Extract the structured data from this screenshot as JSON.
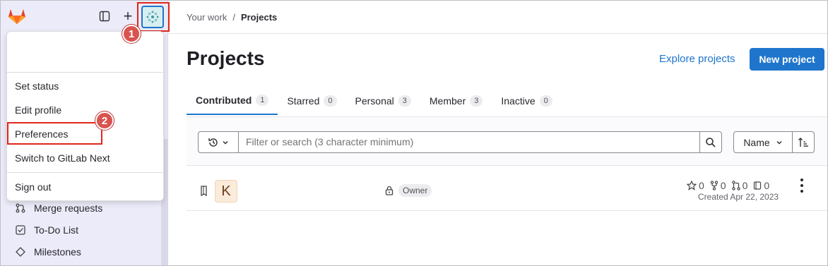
{
  "sidebar": {
    "logo_icon": "gitlab-tanuki-icon",
    "nav": [
      {
        "icon": "merge-request-icon",
        "label": "Merge requests"
      },
      {
        "icon": "todo-icon",
        "label": "To-Do List"
      },
      {
        "icon": "milestone-icon",
        "label": "Milestones"
      }
    ]
  },
  "dropdown": {
    "items": {
      "set_status": "Set status",
      "edit_profile": "Edit profile",
      "preferences": "Preferences",
      "switch_next": "Switch to GitLab Next",
      "sign_out": "Sign out"
    }
  },
  "annotations": {
    "step1": "1",
    "step2": "2"
  },
  "breadcrumb": {
    "parent": "Your work",
    "separator": "/",
    "current": "Projects"
  },
  "page": {
    "title": "Projects",
    "explore_label": "Explore projects",
    "new_project_label": "New project"
  },
  "tabs": [
    {
      "label": "Contributed",
      "count": "1",
      "active": true
    },
    {
      "label": "Starred",
      "count": "0"
    },
    {
      "label": "Personal",
      "count": "3"
    },
    {
      "label": "Member",
      "count": "3"
    },
    {
      "label": "Inactive",
      "count": "0"
    }
  ],
  "filter": {
    "search_placeholder": "Filter or search (3 character minimum)",
    "sort_label": "Name"
  },
  "project": {
    "avatar_letter": "K",
    "role": "Owner",
    "stars": "0",
    "forks": "0",
    "merge_requests": "0",
    "issues": "0",
    "created": "Created Apr 22, 2023"
  },
  "colors": {
    "accent": "#1f75cb",
    "highlight": "#e1261c",
    "sidebar_bg": "#ecebf9"
  }
}
